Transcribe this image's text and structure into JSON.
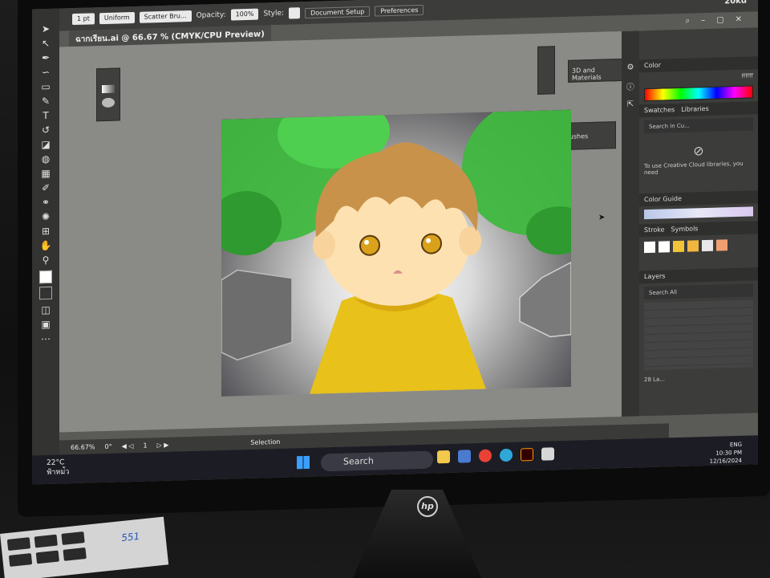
{
  "window": {
    "title": "ฉากเรียน.ai @ 66.67 % (CMYK/CPU Preview)",
    "top_right_label": "20kd"
  },
  "control_bar": {
    "stroke_weight": "1 pt",
    "stroke_profile": "Uniform",
    "brush": "Scatter Bru...",
    "opacity_label": "Opacity:",
    "opacity_value": "100%",
    "style_label": "Style:",
    "document_setup": "Document Setup",
    "preferences": "Preferences"
  },
  "floating_panels": {
    "three_d": "3D and Materials",
    "brushes": "Brushes"
  },
  "right_panels": {
    "color_tab": "Color",
    "hex_value": "ffffff",
    "swatches_tab": "Swatches",
    "libraries_tab": "Libraries",
    "libraries_search": "Search in Cu...",
    "libraries_message": "To use Creative Cloud libraries, you need",
    "color_guide_tab": "Color Guide",
    "stroke_tab": "Stroke",
    "symbols_tab": "Symbols",
    "layers_tab": "Layers",
    "layers_search": "Search All",
    "layers_count": "28 La..."
  },
  "status_bar": {
    "zoom": "66.67%",
    "rotation": "0°",
    "page": "1",
    "tool": "Selection"
  },
  "taskbar": {
    "weather_temp": "22°C",
    "weather_text": "ฟ้าหม่ัว",
    "search_label": "Search",
    "lang": "ENG",
    "time": "10:30 PM",
    "date": "12/16/2024"
  },
  "colors": {
    "hood": "#e8c11a",
    "hair": "#c8924a",
    "leaves": "#3fb83f",
    "skin": "#fde1b0"
  },
  "monitor_brand": "hp",
  "keyboard_label": "551"
}
